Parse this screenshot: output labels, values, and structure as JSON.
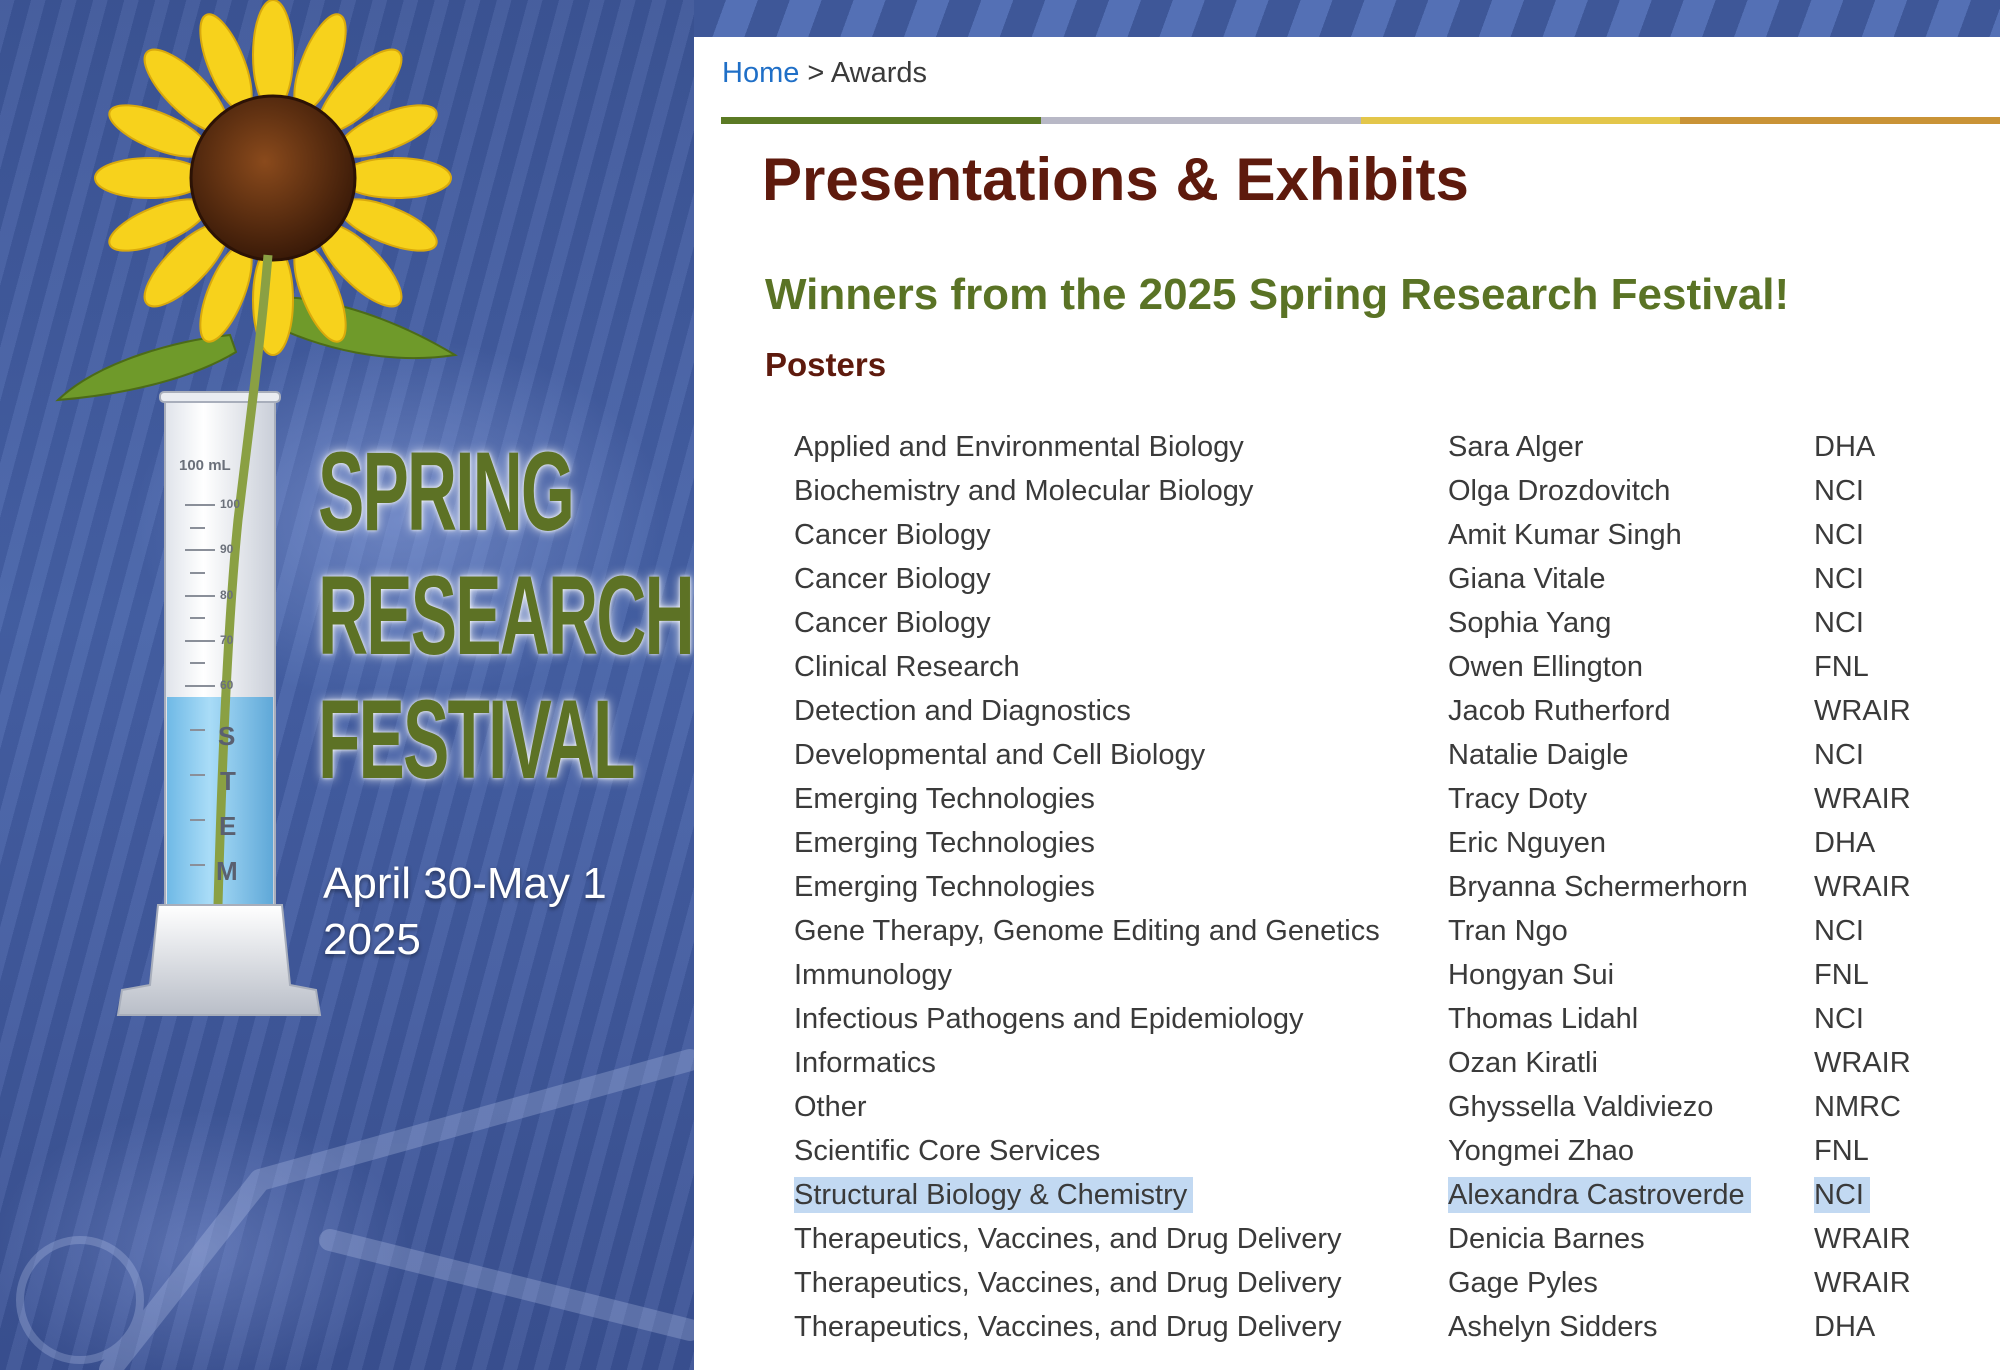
{
  "banner": {
    "title_lines": [
      "SPRING",
      "RESEARCH",
      "FESTIVAL"
    ],
    "date_lines": [
      "April 30-May 1",
      "2025"
    ],
    "cylinder_label": "100 mL",
    "cylinder_ticks": [
      "100",
      "90",
      "80",
      "70",
      "60"
    ],
    "stem_letters": [
      "S",
      "T",
      "E",
      "M"
    ]
  },
  "breadcrumb": {
    "home": "Home",
    "separator": ">",
    "current": "Awards"
  },
  "colors": {
    "bar": [
      "#5b7a24",
      "#b8b8c6",
      "#e3c64a",
      "#c99336"
    ],
    "title": "#5e1a0d",
    "subtitle": "#5a7325",
    "link": "#1f6fc7",
    "selection": "#c2d9f2"
  },
  "page": {
    "title": "Presentations & Exhibits",
    "subtitle": "Winners from the 2025 Spring Research Festival!",
    "section": "Posters"
  },
  "winners": [
    {
      "category": "Applied and Environmental Biology",
      "name": "Sara Alger",
      "institution": "DHA"
    },
    {
      "category": "Biochemistry and Molecular Biology",
      "name": "Olga Drozdovitch",
      "institution": "NCI"
    },
    {
      "category": "Cancer Biology",
      "name": "Amit Kumar Singh",
      "institution": "NCI"
    },
    {
      "category": "Cancer Biology",
      "name": "Giana Vitale",
      "institution": "NCI"
    },
    {
      "category": "Cancer Biology",
      "name": "Sophia Yang",
      "institution": "NCI"
    },
    {
      "category": "Clinical Research",
      "name": "Owen Ellington",
      "institution": "FNL"
    },
    {
      "category": "Detection and Diagnostics",
      "name": "Jacob Rutherford",
      "institution": "WRAIR"
    },
    {
      "category": "Developmental and Cell Biology",
      "name": "Natalie Daigle",
      "institution": "NCI"
    },
    {
      "category": "Emerging Technologies",
      "name": "Tracy Doty",
      "institution": "WRAIR"
    },
    {
      "category": "Emerging Technologies",
      "name": "Eric Nguyen",
      "institution": "DHA"
    },
    {
      "category": "Emerging Technologies",
      "name": "Bryanna Schermerhorn",
      "institution": "WRAIR"
    },
    {
      "category": "Gene Therapy, Genome Editing and Genetics",
      "name": "Tran Ngo",
      "institution": "NCI"
    },
    {
      "category": "Immunology",
      "name": "Hongyan Sui",
      "institution": "FNL"
    },
    {
      "category": "Infectious Pathogens and Epidemiology",
      "name": "Thomas Lidahl",
      "institution": "NCI"
    },
    {
      "category": "Informatics",
      "name": "Ozan Kiratli",
      "institution": "WRAIR"
    },
    {
      "category": "Other",
      "name": "Ghyssella Valdiviezo",
      "institution": "NMRC"
    },
    {
      "category": "Scientific Core Services",
      "name": "Yongmei Zhao",
      "institution": "FNL"
    },
    {
      "category": "Structural Biology & Chemistry",
      "name": "Alexandra Castroverde",
      "institution": "NCI",
      "selected": true
    },
    {
      "category": "Therapeutics, Vaccines, and Drug Delivery",
      "name": "Denicia Barnes",
      "institution": "WRAIR"
    },
    {
      "category": "Therapeutics, Vaccines, and Drug Delivery",
      "name": "Gage Pyles",
      "institution": "WRAIR"
    },
    {
      "category": "Therapeutics, Vaccines, and Drug Delivery",
      "name": "Ashelyn Sidders",
      "institution": "DHA"
    }
  ]
}
